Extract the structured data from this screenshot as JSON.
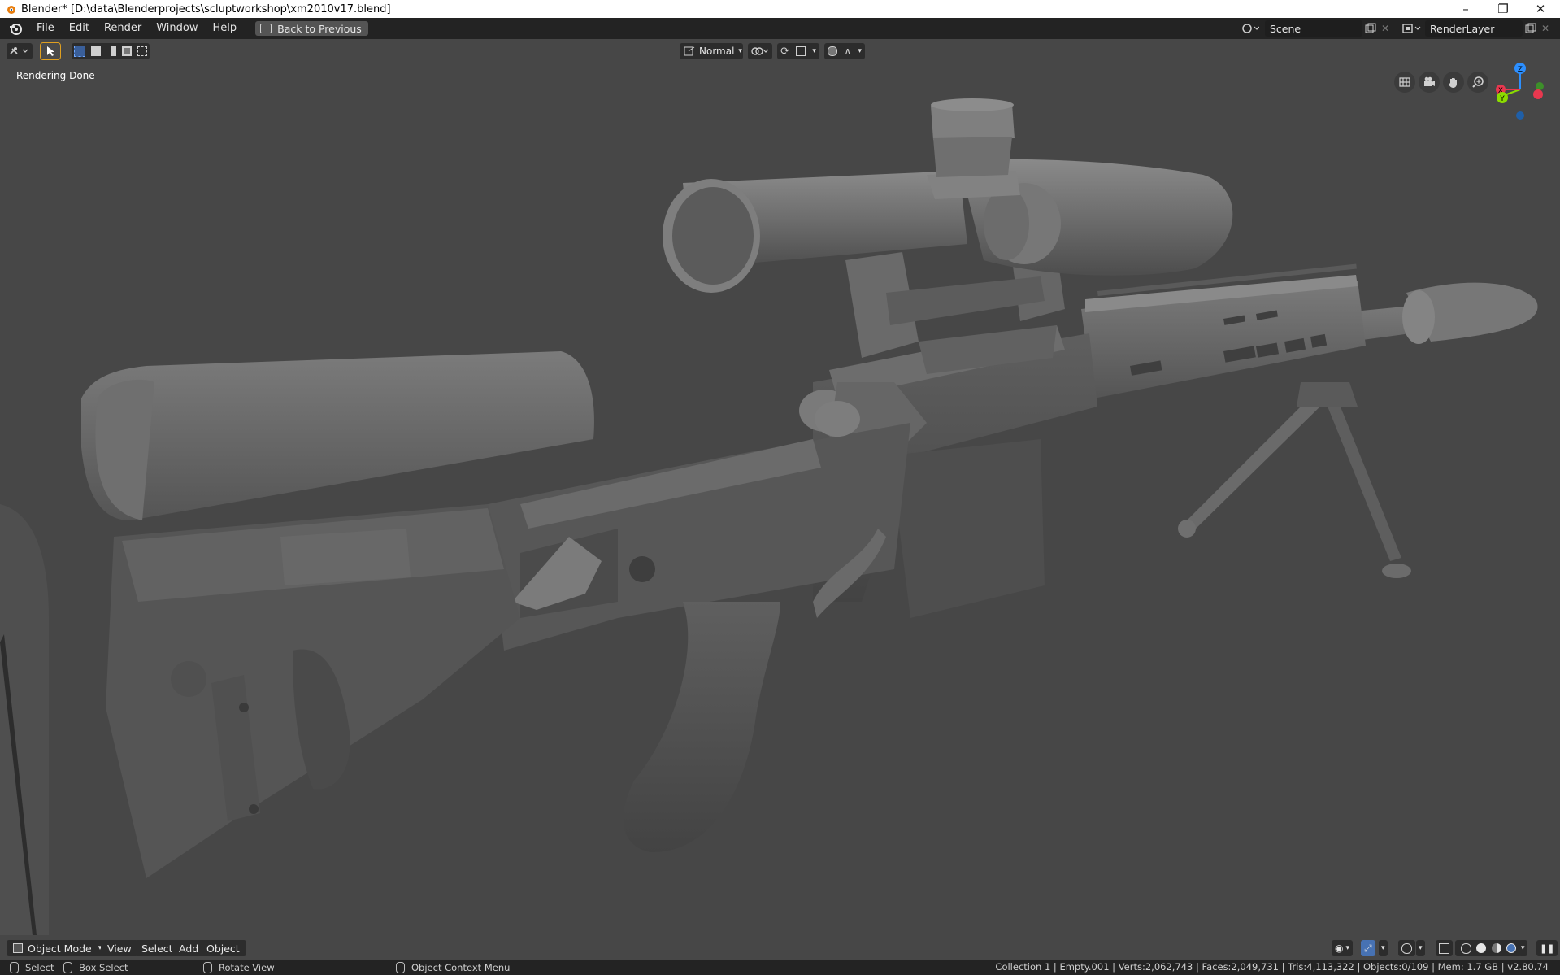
{
  "window": {
    "title": "Blender* [D:\\data\\Blenderprojects\\scluptworkshop\\xm2010v17.blend]",
    "controls": {
      "minimize": "–",
      "restore": "❐",
      "close": "✕"
    }
  },
  "menubar": {
    "items": [
      "File",
      "Edit",
      "Render",
      "Window",
      "Help"
    ],
    "back_button": "Back to Previous",
    "scene": {
      "label": "Scene"
    },
    "render_layer": {
      "label": "RenderLayer"
    }
  },
  "header3d": {
    "transform_orientation": "Normal"
  },
  "viewport": {
    "status_text": "Rendering Done",
    "gizmo": {
      "z": "Z",
      "y": "Y",
      "x": "X"
    }
  },
  "bottom_header": {
    "mode": "Object Mode",
    "menus": [
      "View",
      "Select",
      "Add",
      "Object"
    ]
  },
  "statusbar": {
    "select": "Select",
    "box_select": "Box Select",
    "rotate_view": "Rotate View",
    "context_menu": "Object Context Menu",
    "stats": "Collection 1 | Empty.001 | Verts:2,062,743 | Faces:2,049,731 | Tris:4,113,322 | Objects:0/109 | Mem: 1.7 GB | v2.80.74"
  },
  "colors": {
    "viewport_bg": "#474747",
    "topbar_bg": "#232323",
    "gizmo_x": "#e8384f",
    "gizmo_y": "#8bdc00",
    "gizmo_z": "#2c8fff"
  },
  "icons": [
    "blender-logo",
    "back-icon",
    "scene-icon",
    "render-layer-icon",
    "select-box-icon",
    "grid-icon",
    "camera-icon",
    "hand-icon",
    "zoom-icon",
    "mouse-icon"
  ]
}
